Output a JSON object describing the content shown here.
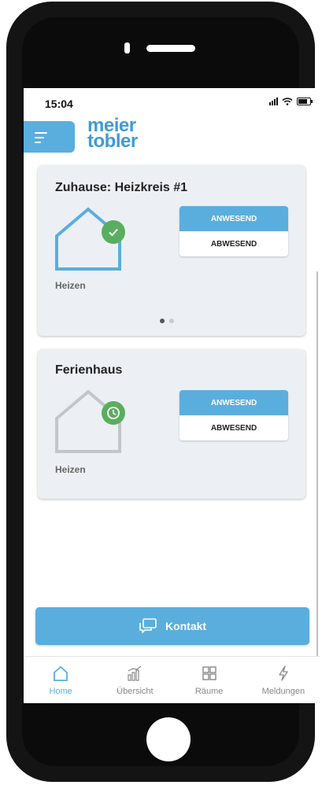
{
  "status_bar": {
    "time": "15:04"
  },
  "header": {
    "logo_line1": "meier",
    "logo_line2": "tobler",
    "brand_color": "#3f9bd6"
  },
  "cards": [
    {
      "title": "Zuhause: Heizkreis #1",
      "mode_label": "Heizen",
      "status_icon": "check-icon",
      "house_color": "#5aaede",
      "buttons": {
        "present": "ANWESEND",
        "absent": "ABWESEND",
        "selected": "present"
      },
      "pager": {
        "pages": 2,
        "current": 1
      }
    },
    {
      "title": "Ferienhaus",
      "mode_label": "Heizen",
      "status_icon": "clock-icon",
      "house_color": "#c3c6c9",
      "buttons": {
        "present": "ANWESEND",
        "absent": "ABWESEND",
        "selected": "present"
      }
    }
  ],
  "contact_button": {
    "label": "Kontakt",
    "icon": "chat-bubbles-icon"
  },
  "tabbar": {
    "items": [
      {
        "label": "Home",
        "icon": "home-icon",
        "active": true
      },
      {
        "label": "Übersicht",
        "icon": "bar-chart-icon",
        "active": false
      },
      {
        "label": "Räume",
        "icon": "grid-icon",
        "active": false
      },
      {
        "label": "Meldungen",
        "icon": "lightning-icon",
        "active": false
      }
    ]
  },
  "colors": {
    "accent": "#5aaede",
    "success": "#5aad5e",
    "card_bg": "#ecf0f4"
  }
}
